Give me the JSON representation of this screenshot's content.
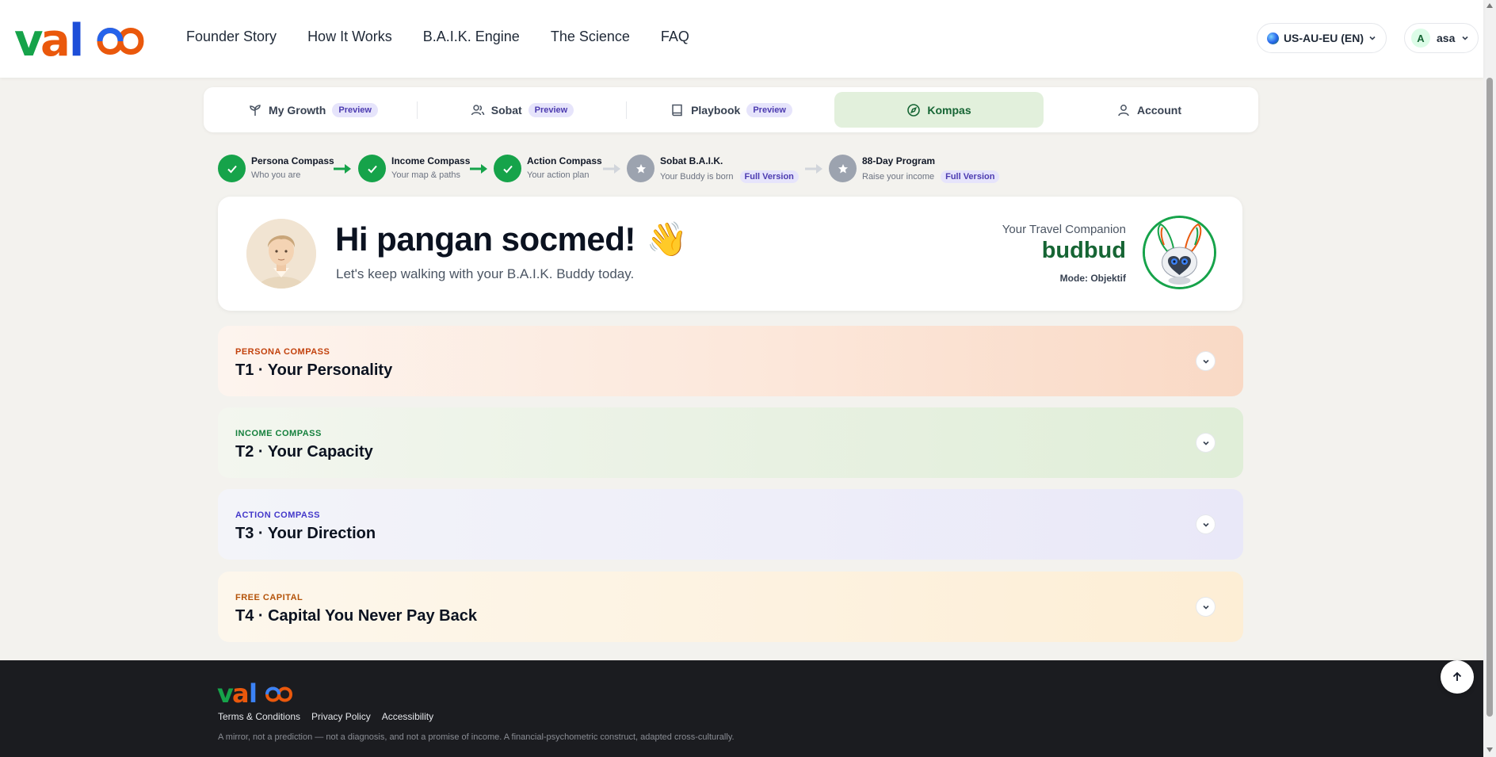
{
  "brand": {
    "name": "valoo"
  },
  "nav": {
    "links": [
      "Founder Story",
      "How It Works",
      "B.A.I.K. Engine",
      "The Science",
      "FAQ"
    ],
    "region": "US-AU-EU (EN)",
    "user": {
      "initial": "A",
      "name": "asa"
    }
  },
  "tabs": [
    {
      "label": "My Growth",
      "badge": "Preview",
      "icon": "sprout-icon"
    },
    {
      "label": "Sobat",
      "badge": "Preview",
      "icon": "users-icon"
    },
    {
      "label": "Playbook",
      "badge": "Preview",
      "icon": "book-icon"
    },
    {
      "label": "Kompas",
      "badge": "",
      "icon": "compass-icon",
      "active": true
    },
    {
      "label": "Account",
      "badge": "",
      "icon": "user-icon"
    }
  ],
  "steps": [
    {
      "title": "Persona Compass",
      "subtitle": "Who you are",
      "status": "done"
    },
    {
      "title": "Income Compass",
      "subtitle": "Your map & paths",
      "status": "done"
    },
    {
      "title": "Action Compass",
      "subtitle": "Your action plan",
      "status": "done"
    },
    {
      "title": "Sobat B.A.I.K.",
      "subtitle": "Your Buddy is born",
      "status": "locked",
      "badge": "Full Version"
    },
    {
      "title": "88-Day Program",
      "subtitle": "Raise your income",
      "status": "locked",
      "badge": "Full Version"
    }
  ],
  "greeting": {
    "title": "Hi pangan socmed!",
    "emoji": "👋",
    "subtitle": "Let's keep walking with your B.A.I.K. Buddy today."
  },
  "companion": {
    "label": "Your Travel Companion",
    "name": "budbud",
    "mode": "Mode: Objektif"
  },
  "sections": [
    {
      "label": "PERSONA COMPASS",
      "title": "T1 · Your Personality"
    },
    {
      "label": "INCOME COMPASS",
      "title": "T2 · Your Capacity"
    },
    {
      "label": "ACTION COMPASS",
      "title": "T3 · Your Direction"
    },
    {
      "label": "FREE CAPITAL",
      "title": "T4 · Capital You Never Pay Back"
    }
  ],
  "footer": {
    "links": [
      "Terms & Conditions",
      "Privacy Policy",
      "Accessibility"
    ],
    "disclaimer": "A mirror, not a prediction — not a diagnosis, and not a promise of income. A financial-psychometric construct, adapted cross-culturally."
  },
  "colors": {
    "brand_green": "#166534",
    "step_done": "#16a34a",
    "step_locked": "#9ca3af",
    "preview_badge": "#e6e4fb",
    "footer_bg": "#1b1c20"
  }
}
